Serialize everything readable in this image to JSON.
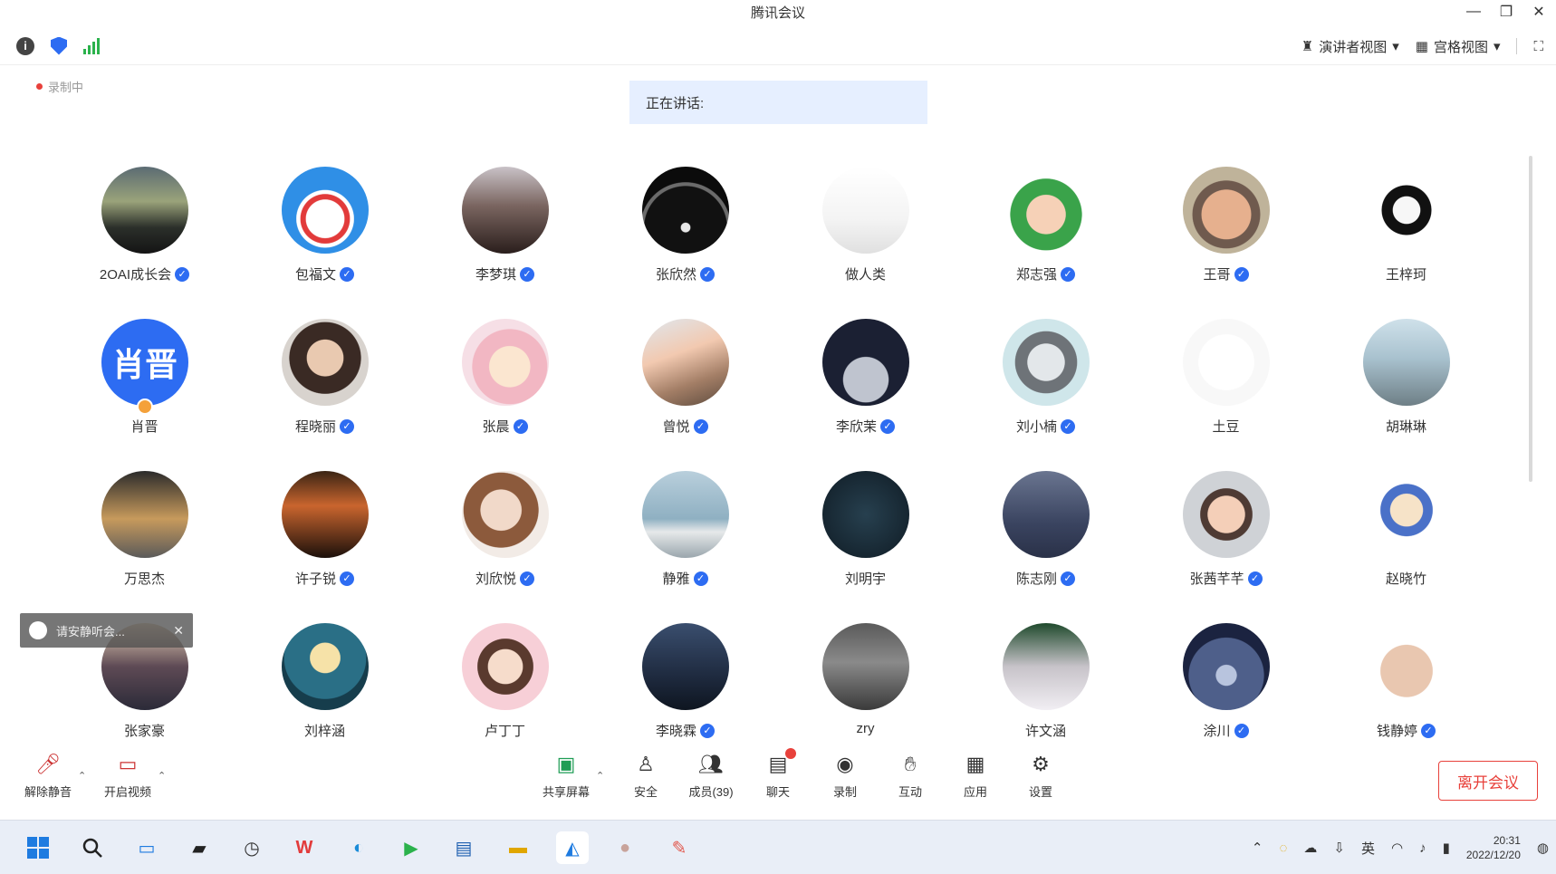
{
  "window": {
    "title": "腾讯会议",
    "minimize": "—",
    "restore": "❐",
    "close": "✕"
  },
  "topbar": {
    "info_icon": "i",
    "view_label": "演讲者视图",
    "layout_label": "宫格视图",
    "fullscreen_icon": "⛶"
  },
  "recording": {
    "label": "录制中"
  },
  "speaking": {
    "label": "正在讲话:"
  },
  "participants": [
    {
      "name": "2OAI成长会",
      "verified": true,
      "bg": "linear-gradient(180deg,#5b6b73 0%,#9aa37a 40%,#2b2f2a 70%,#141414 100%)"
    },
    {
      "name": "包福文",
      "verified": true,
      "bg": "radial-gradient(circle at 50% 60%,#ffffff 0 28%,#e23b3b 29% 36%,#ffffff 37% 42%,#2f8fe6 43%)"
    },
    {
      "name": "李梦琪",
      "verified": true,
      "bg": "linear-gradient(180deg,#c9c2c7 0%,#7a6560 45%,#2a1e1c 100%)"
    },
    {
      "name": "张欣然",
      "verified": true,
      "bg": "radial-gradient(circle at 50% 70%,#e8e8e8 0 6%,#111 7% 55%,#6b6b6b 56% 60%,#0b0b0b 61%)"
    },
    {
      "name": "做人类",
      "verified": false,
      "bg": "linear-gradient(180deg,#ffffff 0%,#f4f4f4 60%,#e0e0e0 100%)"
    },
    {
      "name": "郑志强",
      "verified": true,
      "bg": "radial-gradient(circle at 50% 55%,#f6d1b7 0 30%,#3aa34a 31% 55%,#ffffff 56%)"
    },
    {
      "name": "王哥",
      "verified": true,
      "bg": "radial-gradient(circle at 50% 55%,#e6b08e 0 38%,#6f5a4e 39% 52%,#bfb39a 53%)"
    },
    {
      "name": "王梓珂",
      "verified": false,
      "bg": "radial-gradient(circle at 50% 50%,#f7f7f7 0 22%,#111 23% 40%,#ffffff 41%)"
    },
    {
      "name": "肖晋",
      "verified": false,
      "text_avatar": "肖晋",
      "host": true
    },
    {
      "name": "程晓丽",
      "verified": true,
      "bg": "radial-gradient(circle at 50% 45%,#e9c9b0 0 28%,#3a2a24 29% 55%,#d8d3ce 56%)"
    },
    {
      "name": "张晨",
      "verified": true,
      "bg": "radial-gradient(circle at 55% 55%,#fbe6d0 0 30%,#f2b7c3 31% 55%,#f6dfe6 56%)"
    },
    {
      "name": "曾悦",
      "verified": true,
      "bg": "linear-gradient(160deg,#dfe7ee 0%,#f2c9b0 40%,#a37e66 70%,#5c4a3d 100%)"
    },
    {
      "name": "李欣茉",
      "verified": true,
      "bg": "radial-gradient(circle at 50% 70%,#bfc4cf 0 30%,#1b2033 31%)"
    },
    {
      "name": "刘小楠",
      "verified": true,
      "bg": "radial-gradient(circle at 50% 50%,#e3e7ea 0 30%,#6e7378 31% 50%,#cfe6ea 51%)"
    },
    {
      "name": "土豆",
      "verified": false,
      "bg": "radial-gradient(circle at 50% 50%,#ffffff 0 45%,#f8f8f8 46%)"
    },
    {
      "name": "胡琳琳",
      "verified": false,
      "bg": "linear-gradient(180deg,#cfe1ea 0%,#a9c2cf 45%,#6e7f86 100%)"
    },
    {
      "name": "万思杰",
      "verified": false,
      "bg": "linear-gradient(180deg,#2b2b2b 0%,#c79a5c 55%,#5a5a5a 100%)"
    },
    {
      "name": "许子锐",
      "verified": true,
      "bg": "linear-gradient(180deg,#3a2414 0%,#c9652e 40%,#1b100b 100%)"
    },
    {
      "name": "刘欣悦",
      "verified": true,
      "bg": "radial-gradient(circle at 45% 45%,#f1d9c9 0 30%,#8c5a3c 31% 55%,#f2ebe6 56%)"
    },
    {
      "name": "静雅",
      "verified": true,
      "bg": "linear-gradient(180deg,#b9cfdc 0%,#8fb0c2 55%,#e6e9ea 70%,#9aa6ad 100%)"
    },
    {
      "name": "刘明宇",
      "verified": false,
      "bg": "radial-gradient(circle at 50% 50%,#27404f 0%,#0f1b24 100%)"
    },
    {
      "name": "陈志刚",
      "verified": true,
      "bg": "linear-gradient(180deg,#6a7590 0%,#3a4460 60%,#2a3148 100%)"
    },
    {
      "name": "张茜芊芊",
      "verified": true,
      "bg": "radial-gradient(circle at 50% 50%,#f4cfb8 0 30%,#4f3b34 31% 42%,#cfd2d6 43%)"
    },
    {
      "name": "赵晓竹",
      "verified": false,
      "bg": "radial-gradient(circle at 50% 45%,#f6e3c8 0 25%,#4a71c8 26% 40%,#ffffff 41%)"
    },
    {
      "name": "张家豪",
      "verified": false,
      "bg": "linear-gradient(180deg,#e8d3b7 0%,#5e4a55 50%,#2b2a38 100%)"
    },
    {
      "name": "刘梓涵",
      "verified": false,
      "bg": "radial-gradient(circle at 50% 40%,#f6e2a8 0 22%,#2a6f86 23% 60%,#163d4c 61%)"
    },
    {
      "name": "卢丁丁",
      "verified": false,
      "bg": "radial-gradient(circle at 50% 50%,#f6dccb 0 28%,#5a3a2e 29% 45%,#f7cfd7 46%)"
    },
    {
      "name": "李晓霖",
      "verified": true,
      "bg": "linear-gradient(180deg,#3a4e6e 0%,#1f2b40 60%,#0e1520 100%)"
    },
    {
      "name": "zry",
      "verified": false,
      "bg": "linear-gradient(180deg,#5a5a5a 0%,#8a8a8a 45%,#3a3a3a 100%)"
    },
    {
      "name": "许文涵",
      "verified": false,
      "bg": "linear-gradient(180deg,#1f4a2c 0%,#c7c3c9 50%,#f1eef3 100%)"
    },
    {
      "name": "涂川",
      "verified": true,
      "bg": "radial-gradient(circle at 50% 60%,#b8c4de 0 15%,#4e5f8a 16% 55%,#1b2340 56%)"
    },
    {
      "name": "钱静婷",
      "verified": true,
      "bg": "radial-gradient(circle at 50% 55%,#e9c7b0 0 40%,#ffffff 41%)"
    }
  ],
  "chat_popup": {
    "text": "请安静听会...",
    "close": "✕"
  },
  "toolbar": {
    "mute": "解除静音",
    "video": "开启视频",
    "share": "共享屏幕",
    "security": "安全",
    "members": "成员(39)",
    "chat": "聊天",
    "record": "录制",
    "apps": "互动",
    "apps2": "应用",
    "settings": "设置",
    "leave": "离开会议"
  },
  "taskbar": {
    "lang": "英",
    "time": "20:31",
    "date": "2022/12/20"
  }
}
